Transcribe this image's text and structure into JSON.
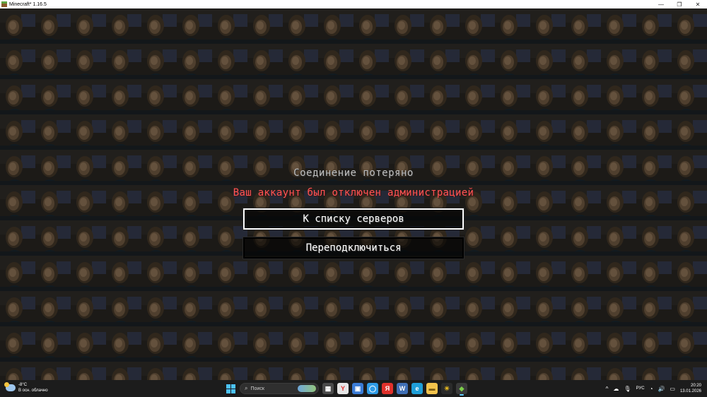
{
  "window": {
    "title": "Minecraft* 1.16.5",
    "minimize": "—",
    "maximize": "❐",
    "close": "✕"
  },
  "screen": {
    "title": "Соединение потеряно",
    "reason": "Ваш аккаунт был отключен администрацией",
    "buttons": {
      "back_to_servers": "К списку серверов",
      "reconnect": "Переподключиться"
    }
  },
  "colors": {
    "reason_text": "#ff5555",
    "title_text": "#bfbfbf",
    "button_text": "#ffffff",
    "taskbar": "#1c1c1c"
  },
  "taskbar": {
    "weather": {
      "temp": "-8°C",
      "desc": "В осн. облачно",
      "icon": "partly-cloudy-icon"
    },
    "search_placeholder": "Поиск",
    "apps": [
      {
        "name": "file-explorer-icon",
        "glyph": "▦",
        "color": "#4a4a4a"
      },
      {
        "name": "yandex-browser-icon",
        "glyph": "Y",
        "color": "#e6e6e6"
      },
      {
        "name": "phone-link-icon",
        "glyph": "▣",
        "color": "#3a7bd5"
      },
      {
        "name": "messenger-icon",
        "glyph": "◯",
        "color": "#2e9be6"
      },
      {
        "name": "yandex-icon",
        "glyph": "Я",
        "color": "#e0312b"
      },
      {
        "name": "vk-icon",
        "glyph": "W",
        "color": "#3f6fb5"
      },
      {
        "name": "edge-icon",
        "glyph": "e",
        "color": "#1f9fd8"
      },
      {
        "name": "folder-icon",
        "glyph": "▬",
        "color": "#f2c34c"
      },
      {
        "name": "sun-app-icon",
        "glyph": "☀",
        "color": "#d9a400"
      },
      {
        "name": "minecraft-icon",
        "glyph": "◆",
        "color": "#5da33f"
      }
    ],
    "tray": {
      "chevron": "^",
      "lang": "РУС",
      "time": "20:20",
      "date": "13.01.2026"
    }
  }
}
